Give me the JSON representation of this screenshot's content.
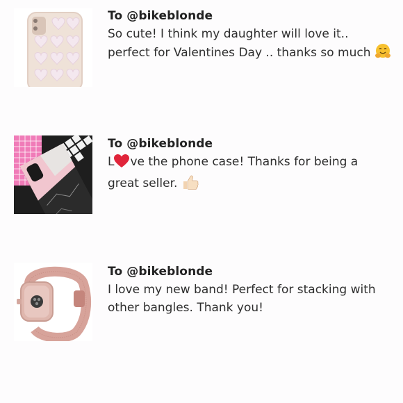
{
  "reviews": [
    {
      "recipient": "To @bikeblonde",
      "message": "So cute! I think my daughter will love it.. perfect for Valentines Day .. thanks so much",
      "emoji": "hugging-face-emoji",
      "image": "clear-heart-phone-case"
    },
    {
      "recipient": "To @bikeblonde",
      "message_prefix": "L",
      "message": "ve the phone case! Thanks for being a great seller.",
      "inline_emoji": "red-heart-emoji",
      "emoji": "thumbs-up-emoji",
      "image": "marble-phone-case"
    },
    {
      "recipient": "To @bikeblonde",
      "message": "I love my new band! Perfect for stacking with other bangles. Thank you!",
      "image": "rose-gold-milanese-watch-band"
    }
  ],
  "colors": {
    "background": "#fdfcfd",
    "text": "#2e2e2e",
    "recipient": "#222222",
    "heart": "#e0243a",
    "emoji_yellow": "#f7c12f"
  }
}
